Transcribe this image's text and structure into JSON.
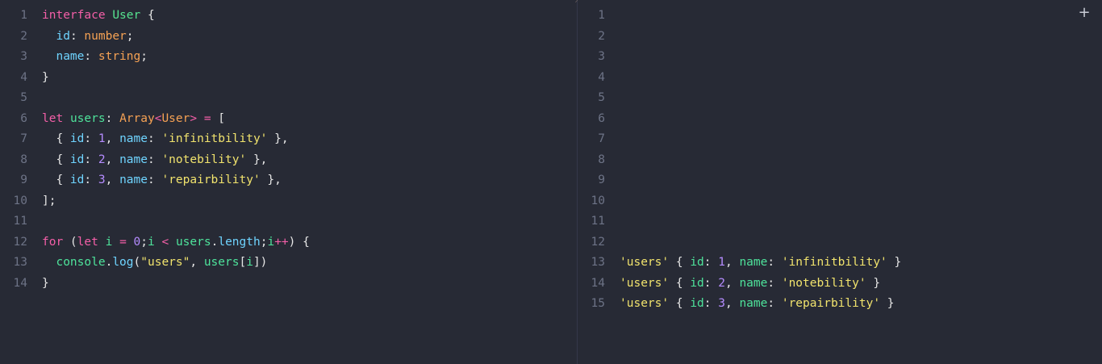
{
  "editor": {
    "lines": [
      [
        {
          "t": "interface",
          "c": "kw"
        },
        {
          "t": " ",
          "c": "plain"
        },
        {
          "t": "User",
          "c": "cls"
        },
        {
          "t": " {",
          "c": "punc"
        }
      ],
      [
        {
          "t": "  ",
          "c": "plain"
        },
        {
          "t": "id",
          "c": "prop"
        },
        {
          "t": ": ",
          "c": "punc"
        },
        {
          "t": "number",
          "c": "type"
        },
        {
          "t": ";",
          "c": "punc"
        }
      ],
      [
        {
          "t": "  ",
          "c": "plain"
        },
        {
          "t": "name",
          "c": "prop"
        },
        {
          "t": ": ",
          "c": "punc"
        },
        {
          "t": "string",
          "c": "type"
        },
        {
          "t": ";",
          "c": "punc"
        }
      ],
      [
        {
          "t": "}",
          "c": "punc"
        }
      ],
      [],
      [
        {
          "t": "let",
          "c": "kw"
        },
        {
          "t": " ",
          "c": "plain"
        },
        {
          "t": "users",
          "c": "var"
        },
        {
          "t": ": ",
          "c": "punc"
        },
        {
          "t": "Array",
          "c": "type"
        },
        {
          "t": "<",
          "c": "op"
        },
        {
          "t": "User",
          "c": "type"
        },
        {
          "t": ">",
          "c": "op"
        },
        {
          "t": " ",
          "c": "plain"
        },
        {
          "t": "=",
          "c": "op"
        },
        {
          "t": " [",
          "c": "punc"
        }
      ],
      [
        {
          "t": "  { ",
          "c": "punc"
        },
        {
          "t": "id",
          "c": "prop"
        },
        {
          "t": ": ",
          "c": "punc"
        },
        {
          "t": "1",
          "c": "num"
        },
        {
          "t": ", ",
          "c": "punc"
        },
        {
          "t": "name",
          "c": "prop"
        },
        {
          "t": ": ",
          "c": "punc"
        },
        {
          "t": "'infinitbility'",
          "c": "str"
        },
        {
          "t": " },",
          "c": "punc"
        }
      ],
      [
        {
          "t": "  { ",
          "c": "punc"
        },
        {
          "t": "id",
          "c": "prop"
        },
        {
          "t": ": ",
          "c": "punc"
        },
        {
          "t": "2",
          "c": "num"
        },
        {
          "t": ", ",
          "c": "punc"
        },
        {
          "t": "name",
          "c": "prop"
        },
        {
          "t": ": ",
          "c": "punc"
        },
        {
          "t": "'notebility'",
          "c": "str"
        },
        {
          "t": " },",
          "c": "punc"
        }
      ],
      [
        {
          "t": "  { ",
          "c": "punc"
        },
        {
          "t": "id",
          "c": "prop"
        },
        {
          "t": ": ",
          "c": "punc"
        },
        {
          "t": "3",
          "c": "num"
        },
        {
          "t": ", ",
          "c": "punc"
        },
        {
          "t": "name",
          "c": "prop"
        },
        {
          "t": ": ",
          "c": "punc"
        },
        {
          "t": "'repairbility'",
          "c": "str"
        },
        {
          "t": " },",
          "c": "punc"
        }
      ],
      [
        {
          "t": "];",
          "c": "punc"
        }
      ],
      [],
      [
        {
          "t": "for",
          "c": "kw"
        },
        {
          "t": " (",
          "c": "punc"
        },
        {
          "t": "let",
          "c": "kw"
        },
        {
          "t": " ",
          "c": "plain"
        },
        {
          "t": "i",
          "c": "var"
        },
        {
          "t": " ",
          "c": "plain"
        },
        {
          "t": "=",
          "c": "op"
        },
        {
          "t": " ",
          "c": "plain"
        },
        {
          "t": "0",
          "c": "num"
        },
        {
          "t": ";",
          "c": "punc"
        },
        {
          "t": "i",
          "c": "var"
        },
        {
          "t": " ",
          "c": "plain"
        },
        {
          "t": "<",
          "c": "op"
        },
        {
          "t": " ",
          "c": "plain"
        },
        {
          "t": "users",
          "c": "var"
        },
        {
          "t": ".",
          "c": "punc"
        },
        {
          "t": "length",
          "c": "prop"
        },
        {
          "t": ";",
          "c": "punc"
        },
        {
          "t": "i",
          "c": "var"
        },
        {
          "t": "++",
          "c": "op"
        },
        {
          "t": ") {",
          "c": "punc"
        }
      ],
      [
        {
          "t": "  ",
          "c": "plain"
        },
        {
          "t": "console",
          "c": "var"
        },
        {
          "t": ".",
          "c": "punc"
        },
        {
          "t": "log",
          "c": "fn"
        },
        {
          "t": "(",
          "c": "punc"
        },
        {
          "t": "\"users\"",
          "c": "str"
        },
        {
          "t": ", ",
          "c": "punc"
        },
        {
          "t": "users",
          "c": "var"
        },
        {
          "t": "[",
          "c": "punc"
        },
        {
          "t": "i",
          "c": "var"
        },
        {
          "t": "])",
          "c": "punc"
        }
      ],
      [
        {
          "t": "}",
          "c": "punc"
        }
      ]
    ]
  },
  "output": {
    "plus_label": "+",
    "lines": [
      [],
      [],
      [],
      [],
      [],
      [],
      [],
      [],
      [],
      [],
      [],
      [],
      [
        {
          "t": "'users'",
          "c": "str"
        },
        {
          "t": " { ",
          "c": "punc"
        },
        {
          "t": "id",
          "c": "var"
        },
        {
          "t": ": ",
          "c": "punc"
        },
        {
          "t": "1",
          "c": "num"
        },
        {
          "t": ", ",
          "c": "punc"
        },
        {
          "t": "name",
          "c": "var"
        },
        {
          "t": ": ",
          "c": "punc"
        },
        {
          "t": "'infinitbility'",
          "c": "str"
        },
        {
          "t": " }",
          "c": "punc"
        }
      ],
      [
        {
          "t": "'users'",
          "c": "str"
        },
        {
          "t": " { ",
          "c": "punc"
        },
        {
          "t": "id",
          "c": "var"
        },
        {
          "t": ": ",
          "c": "punc"
        },
        {
          "t": "2",
          "c": "num"
        },
        {
          "t": ", ",
          "c": "punc"
        },
        {
          "t": "name",
          "c": "var"
        },
        {
          "t": ": ",
          "c": "punc"
        },
        {
          "t": "'notebility'",
          "c": "str"
        },
        {
          "t": " }",
          "c": "punc"
        }
      ],
      [
        {
          "t": "'users'",
          "c": "str"
        },
        {
          "t": " { ",
          "c": "punc"
        },
        {
          "t": "id",
          "c": "var"
        },
        {
          "t": ": ",
          "c": "punc"
        },
        {
          "t": "3",
          "c": "num"
        },
        {
          "t": ", ",
          "c": "punc"
        },
        {
          "t": "name",
          "c": "var"
        },
        {
          "t": ": ",
          "c": "punc"
        },
        {
          "t": "'repairbility'",
          "c": "str"
        },
        {
          "t": " }",
          "c": "punc"
        }
      ]
    ]
  }
}
